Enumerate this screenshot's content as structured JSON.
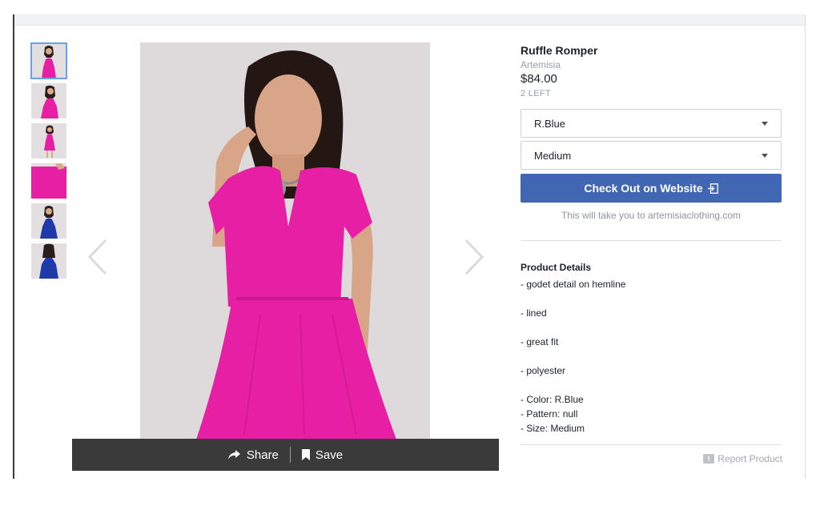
{
  "product": {
    "title": "Ruffle Romper",
    "brand": "Artemisia",
    "price": "$84.00",
    "stock": "2 LEFT"
  },
  "options": {
    "color_selected": "R.Blue",
    "size_selected": "Medium"
  },
  "checkout": {
    "button_label": "Check Out on Website",
    "note": "This will take you to artemisiaclothing.com"
  },
  "details": {
    "heading": "Product Details",
    "items": [
      "- godet detail on hemline",
      "- lined",
      "- great fit",
      "- polyester",
      "- Color: R.Blue",
      "- Pattern: null",
      "- Size: Medium"
    ]
  },
  "actions": {
    "share_label": "Share",
    "save_label": "Save",
    "report_label": "Report Product",
    "report_icon_text": "!"
  },
  "gallery": {
    "thumbnail_count": 6,
    "selected_index": 0,
    "thumbnail_colors": [
      "#e61fa4",
      "#e61fa4",
      "#e61fa4",
      "#e61fa4",
      "#1d3aa8",
      "#1d3aa8"
    ]
  },
  "colors": {
    "accent": "#4267b2",
    "dress_pink": "#e61fa4",
    "dress_blue": "#1d3aa8",
    "share_bar": "#3a3a3a"
  },
  "icons": {
    "prev": "chevron-left-icon",
    "next": "chevron-right-icon",
    "share": "share-arrow-icon",
    "save": "bookmark-icon",
    "external": "external-link-icon",
    "report": "report-flag-icon"
  }
}
